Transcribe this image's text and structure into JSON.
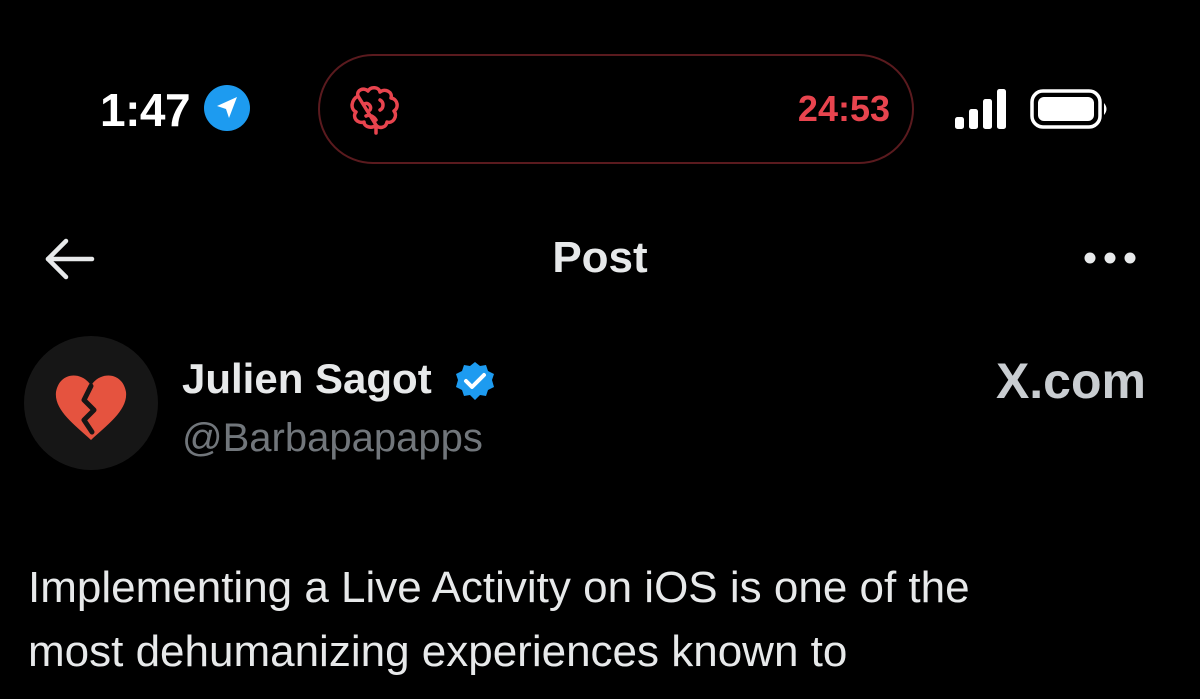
{
  "status_bar": {
    "time": "1:47",
    "timer": "24:53",
    "icons": [
      "location-arrow-icon",
      "brain-icon",
      "cellular-signal-icon",
      "battery-icon"
    ]
  },
  "nav": {
    "title": "Post",
    "icons": [
      "back-arrow-icon",
      "more-options-icon"
    ]
  },
  "author": {
    "name": "Julien Sagot",
    "handle": "@Barbapapapps",
    "avatar_icon": "broken-heart-icon",
    "verified_icon": "verified-badge-icon"
  },
  "watermark": "X.com",
  "post": {
    "lines": [
      "Implementing a Live Activity on iOS is one of the",
      "most dehumanizing experiences known to"
    ]
  },
  "colors": {
    "background": "#000000",
    "accent_blue": "#1d9bf0",
    "timer_red": "#e8444e",
    "island_border": "#5a1a1e",
    "heart_red": "#e5533f",
    "secondary_text": "#71767b"
  }
}
